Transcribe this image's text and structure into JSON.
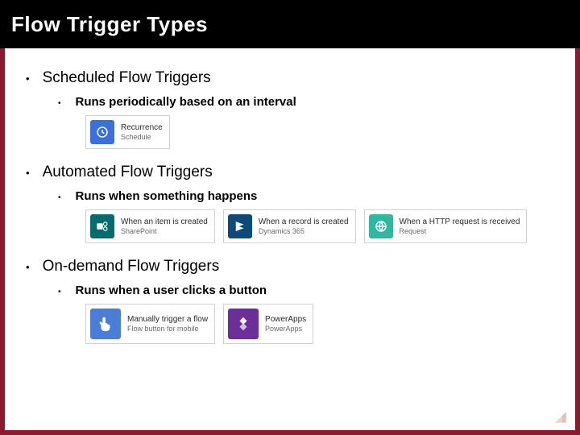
{
  "title": "Flow Trigger Types",
  "sections": [
    {
      "heading": "Scheduled Flow Triggers",
      "sub": "Runs periodically based on an interval",
      "cards": [
        {
          "title": "Recurrence",
          "sub": "Schedule",
          "color": "icon-blue",
          "icon": "clock"
        }
      ]
    },
    {
      "heading": "Automated Flow Triggers",
      "sub": "Runs when something happens",
      "cards": [
        {
          "title": "When an item is created",
          "sub": "SharePoint",
          "color": "icon-teal",
          "icon": "share"
        },
        {
          "title": "When a record is created",
          "sub": "Dynamics 365",
          "color": "icon-navy",
          "icon": "diamond"
        },
        {
          "title": "When a HTTP request is received",
          "sub": "Request",
          "color": "icon-mint",
          "icon": "http"
        }
      ]
    },
    {
      "heading": "On-demand Flow Triggers",
      "sub": "Runs when a user clicks a button",
      "cards": [
        {
          "title": "Manually trigger a flow",
          "sub": "Flow button for mobile",
          "color": "icon-lightblue",
          "icon": "tap"
        },
        {
          "title": "PowerApps",
          "sub": "PowerApps",
          "color": "icon-purple",
          "icon": "apps"
        }
      ]
    }
  ]
}
